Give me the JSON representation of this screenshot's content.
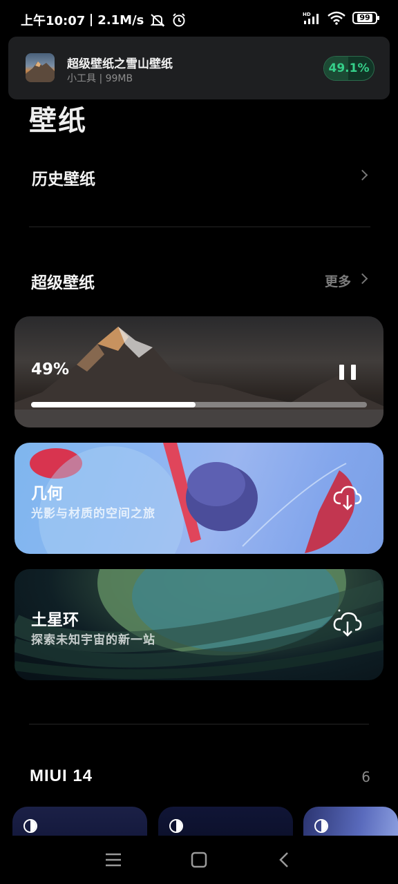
{
  "status_bar": {
    "time": "上午10:07",
    "speed": "2.1M/s",
    "network_badge": "HD",
    "battery": "99",
    "icons": [
      "mute-icon",
      "alarm-icon",
      "signal-icon",
      "wifi-icon",
      "battery-icon"
    ]
  },
  "notification": {
    "title": "超级壁纸之雪山壁纸",
    "subtitle": "小工具 | 99MB",
    "progress_label": "49.1%",
    "progress": 0.491,
    "accent": "#35d08a"
  },
  "page": {
    "title": "壁纸"
  },
  "history": {
    "label": "历史壁纸"
  },
  "super_wallpaper": {
    "label": "超级壁纸",
    "more_label": "更多",
    "download_card": {
      "percent_label": "49%",
      "progress": 0.49
    },
    "cards": [
      {
        "title": "几何",
        "subtitle": "光影与材质的空间之旅"
      },
      {
        "title": "土星环",
        "subtitle": "探索未知宇宙的新一站"
      }
    ]
  },
  "miui": {
    "title": "MIUI  14",
    "count": "6"
  },
  "nav": {
    "icons": [
      "menu-icon",
      "home-icon",
      "back-icon"
    ]
  }
}
